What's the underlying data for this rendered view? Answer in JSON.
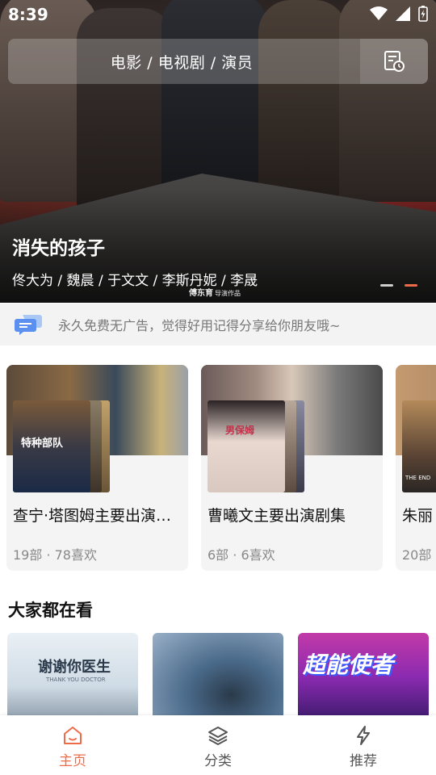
{
  "status_bar": {
    "time": "8:39"
  },
  "search": {
    "placeholder": "电影 / 电视剧 / 演员",
    "history_icon": "history-list-icon"
  },
  "banner": {
    "title": "消失的孩子",
    "cast": "佟大为 / 魏晨 / 于文文 / 李斯丹妮 / 李晟",
    "watermark_main": "傅东育",
    "watermark_sub": "导演作品",
    "page_count": 2,
    "active_page": 2
  },
  "notice": {
    "icon": "chat-bubbles-icon",
    "text": "永久免费无广告，觉得好用记得分享给你朋友哦~"
  },
  "collections": [
    {
      "title": "查宁·塔图姆主要出演…",
      "meta": "19部 · 78喜欢",
      "poster_text": "特种部队"
    },
    {
      "title": "曹曦文主要出演剧集",
      "meta": "6部 · 6喜欢",
      "poster_text": "男保姆"
    },
    {
      "title": "朱丽",
      "meta": "20部",
      "poster_text": "THE END"
    }
  ],
  "section": {
    "title": "大家都在看"
  },
  "popular": [
    {
      "poster_text": "谢谢你医生",
      "poster_sub": "THANK YOU DOCTOR"
    },
    {
      "poster_text": ""
    },
    {
      "poster_text": "超能使者"
    }
  ],
  "tabs": [
    {
      "label": "主页",
      "icon": "home-icon",
      "active": true
    },
    {
      "label": "分类",
      "icon": "layers-icon",
      "active": false
    },
    {
      "label": "推荐",
      "icon": "lightning-icon",
      "active": false
    }
  ],
  "colors": {
    "accent": "#ee6b4a",
    "notice_bg": "#f3f3f3",
    "card_bg": "#f4f4f4"
  }
}
